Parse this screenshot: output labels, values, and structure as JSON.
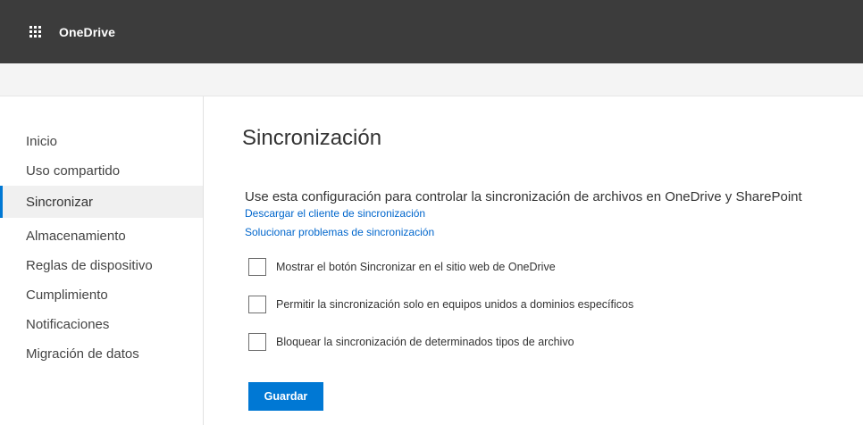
{
  "header": {
    "app_launcher_icon": "waffle-grid-icon",
    "brand": "OneDrive"
  },
  "sidebar": {
    "items": [
      {
        "label": "Inicio"
      },
      {
        "label": "Uso compartido"
      },
      {
        "label": "Sincronizar",
        "active": true
      },
      {
        "label": "Almacenamiento"
      },
      {
        "label": "Reglas de dispositivo"
      },
      {
        "label": "Cumplimiento"
      },
      {
        "label": "Notificaciones"
      },
      {
        "label": "Migración de datos"
      }
    ]
  },
  "main": {
    "title": "Sincronización",
    "description": "Use esta configuración para controlar la sincronización de archivos en OneDrive y SharePoint",
    "links": [
      "Descargar el cliente de sincronización",
      "Solucionar problemas de sincronización"
    ],
    "options": [
      {
        "label": "Mostrar el botón Sincronizar en el sitio web de OneDrive",
        "checked": false
      },
      {
        "label": "Permitir la sincronización solo en equipos unidos a dominios específicos",
        "checked": false
      },
      {
        "label": "Bloquear la sincronización de determinados tipos de archivo",
        "checked": false
      }
    ],
    "save_label": "Guardar"
  },
  "colors": {
    "topbar": "#3c3c3c",
    "accent": "#0078d4",
    "link": "#0066cc"
  }
}
